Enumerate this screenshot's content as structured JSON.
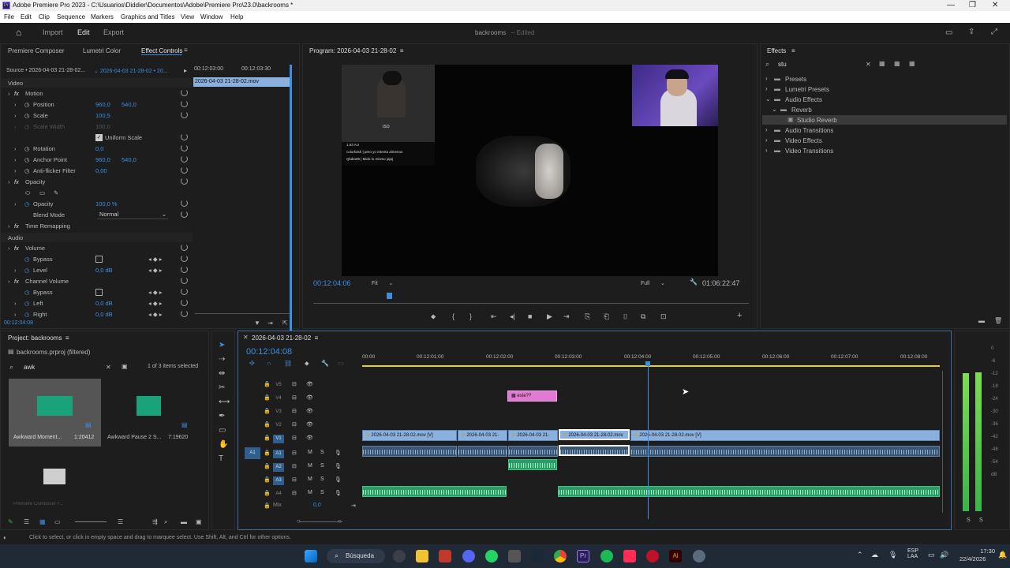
{
  "window": {
    "title": "Adobe Premiere Pro 2023 - C:\\Usuarios\\Diddier\\Documentos\\Adobe\\Premiere Pro\\23.0\\backrooms *",
    "controls": [
      "—",
      "❐",
      "✕"
    ]
  },
  "menu": [
    "File",
    "Edit",
    "Clip",
    "Sequence",
    "Markers",
    "Graphics and Titles",
    "View",
    "Window",
    "Help"
  ],
  "workspace": {
    "tabs": [
      "Import",
      "Edit",
      "Export"
    ],
    "active_tab": "Edit",
    "project_name": "backrooms",
    "status": "Edited"
  },
  "effect_controls": {
    "tabs": [
      "Premiere Composer",
      "Lumetri Color",
      "Effect Controls"
    ],
    "source": "Source • 2026-04-03 21-28-02...",
    "sequence": "2026-04-03 21-28-02 • 20...",
    "time_start": "00:12:03:00",
    "time_end": "00:12:03:30",
    "clip_name": "2026-04-03 21-28-02.mov",
    "video_label": "Video",
    "motion": "Motion",
    "position_label": "Position",
    "position_x": "960,0",
    "position_y": "540,0",
    "scale_label": "Scale",
    "scale_value": "100,5",
    "scale_width_label": "Scale Width",
    "scale_width_value": "100,0",
    "uniform_scale": "Uniform Scale",
    "rotation_label": "Rotation",
    "rotation_value": "0,0",
    "anchor_label": "Anchor Point",
    "anchor_x": "960,0",
    "anchor_y": "540,0",
    "antiflicker_label": "Anti-flicker Filter",
    "antiflicker_value": "0,00",
    "opacity_section": "Opacity",
    "opacity_label": "Opacity",
    "opacity_value": "100,0 %",
    "blend_label": "Blend Mode",
    "blend_value": "Normal",
    "time_remap": "Time Remapping",
    "audio_label": "Audio",
    "volume": "Volume",
    "bypass_label": "Bypass",
    "level_label": "Level",
    "level_value": "0,0 dB",
    "channel_volume": "Channel Volume",
    "left_label": "Left",
    "left_value": "0,0 dB",
    "right_label": "Right",
    "right_value": "0,0 dB",
    "current_time": "00:12:04:08"
  },
  "program_monitor": {
    "title": "Program: 2026-04-03 21-28-02",
    "timecode": "00:12:04:06",
    "fit": "Fit",
    "quality": "Full",
    "duration": "01:06:22:47",
    "overlay_price": "1,63 AU",
    "chat_line1": "colorfulsh | pero yo Intenta almenos",
    "chat_line2": "Qlubo06 | Mido lo mismo jajaj",
    "cam_caption": "ISO"
  },
  "effects_panel": {
    "title": "Effects",
    "search_value": "stu",
    "tree": [
      {
        "label": "Presets",
        "depth": 0,
        "open": false
      },
      {
        "label": "Lumetri Presets",
        "depth": 0,
        "open": false
      },
      {
        "label": "Audio Effects",
        "depth": 0,
        "open": true
      },
      {
        "label": "Reverb",
        "depth": 1,
        "open": true
      },
      {
        "label": "Studio Reverb",
        "depth": 2,
        "selected": true
      },
      {
        "label": "Audio Transitions",
        "depth": 0,
        "open": false
      },
      {
        "label": "Video Effects",
        "depth": 0,
        "open": false
      },
      {
        "label": "Video Transitions",
        "depth": 0,
        "open": false
      }
    ]
  },
  "project": {
    "title": "Project: backrooms",
    "file": "backrooms.prproj (filtered)",
    "search_value": "awk",
    "selection_info": "1 of 3 items selected",
    "items": [
      {
        "name": "Awkward Moment...",
        "duration": "1:20412"
      },
      {
        "name": "Awkward Pause 2 S...",
        "duration": "7:19620"
      },
      {
        "name": "Premiere Composer F...",
        "duration": ""
      }
    ]
  },
  "timeline": {
    "title": "2026-04-03 21-28-02",
    "timecode": "00:12:04:08",
    "ruler": [
      "00:00",
      "00:12:01:00",
      "00:12:02:00",
      "00:12:03:00",
      "00:12:04:00",
      "00:12:05:00",
      "00:12:06:00",
      "00:12:07:00",
      "00:12:08:00"
    ],
    "video_tracks": [
      "V5",
      "V4",
      "V3",
      "V2",
      "V1"
    ],
    "audio_tracks": [
      "A1",
      "A2",
      "A3",
      "A4"
    ],
    "source_patch_a": "A1",
    "mix_label": "Mix",
    "mix_value": "0,0",
    "clips_v1": [
      "2026-04-03 21-28-02.mov [V]",
      "2026-04-03 21-",
      "2026-04-03 21-",
      "2026-04-03 21-28-02.mov",
      "2026-04-03 21-28-02.mov [V]"
    ],
    "title_clip": "este??"
  },
  "meters": {
    "labels": [
      "S",
      "S"
    ],
    "scale": [
      "0",
      "-6",
      "-12",
      "-18",
      "-24",
      "-30",
      "-36",
      "-42",
      "-48",
      "-54",
      "dB"
    ]
  },
  "status_bar": "Click to select, or click in empty space and drag to marquee select. Use Shift, Alt, and Ctrl for other options.",
  "taskbar": {
    "search": "Búsqueda",
    "lang1": "ESP",
    "lang2": "LAA",
    "time": "17:30",
    "date": "22/4/2026"
  }
}
